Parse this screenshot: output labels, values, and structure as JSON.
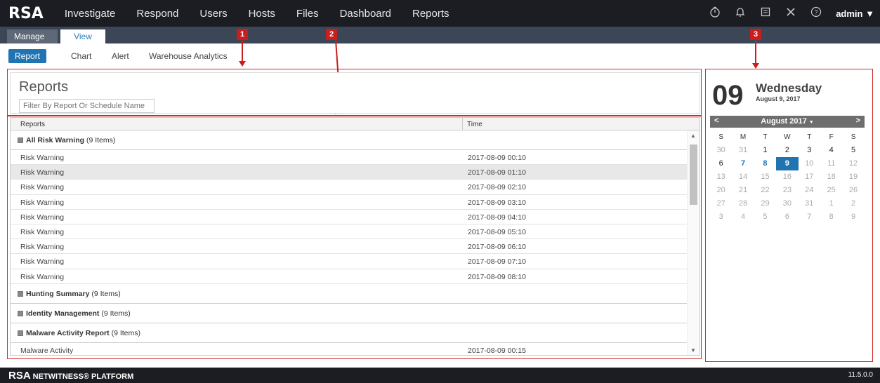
{
  "app": {
    "logo": "RSA",
    "nav": [
      "Investigate",
      "Respond",
      "Users",
      "Hosts",
      "Files",
      "Dashboard",
      "Reports"
    ],
    "user": "admin",
    "icons": [
      "timer-icon",
      "bell-icon",
      "notes-icon",
      "tools-icon",
      "help-icon"
    ]
  },
  "tabs": {
    "manage": "Manage",
    "view": "View"
  },
  "subtabs": [
    "Report",
    "Chart",
    "Alert",
    "Warehouse Analytics"
  ],
  "markers": [
    "1",
    "2",
    "3"
  ],
  "reports": {
    "title": "Reports",
    "filter_placeholder": "Filter By Report Or Schedule Name",
    "col_reports": "Reports",
    "col_time": "Time",
    "groups": [
      {
        "name": "All Risk Warning",
        "count": "(9 Items)"
      },
      {
        "name": "Hunting Summary",
        "count": "(9 Items)"
      },
      {
        "name": "Identity Management",
        "count": "(9 Items)"
      },
      {
        "name": "Malware Activity Report",
        "count": "(9 Items)"
      }
    ],
    "risk_rows": [
      {
        "name": "Risk Warning",
        "time": "2017-08-09 00:10"
      },
      {
        "name": "Risk Warning",
        "time": "2017-08-09 01:10"
      },
      {
        "name": "Risk Warning",
        "time": "2017-08-09 02:10"
      },
      {
        "name": "Risk Warning",
        "time": "2017-08-09 03:10"
      },
      {
        "name": "Risk Warning",
        "time": "2017-08-09 04:10"
      },
      {
        "name": "Risk Warning",
        "time": "2017-08-09 05:10"
      },
      {
        "name": "Risk Warning",
        "time": "2017-08-09 06:10"
      },
      {
        "name": "Risk Warning",
        "time": "2017-08-09 07:10"
      },
      {
        "name": "Risk Warning",
        "time": "2017-08-09 08:10"
      }
    ],
    "malware_rows": [
      {
        "name": "Malware Activity",
        "time": "2017-08-09 00:15"
      }
    ]
  },
  "calendar": {
    "day_number": "09",
    "weekday": "Wednesday",
    "full_date": "August 9, 2017",
    "month_label": "August 2017",
    "prev": "<",
    "next": ">",
    "dow": [
      "S",
      "M",
      "T",
      "W",
      "T",
      "F",
      "S"
    ],
    "weeks": [
      [
        "30",
        "31",
        "1",
        "2",
        "3",
        "4",
        "5"
      ],
      [
        "6",
        "7",
        "8",
        "9",
        "10",
        "11",
        "12"
      ],
      [
        "13",
        "14",
        "15",
        "16",
        "17",
        "18",
        "19"
      ],
      [
        "20",
        "21",
        "22",
        "23",
        "24",
        "25",
        "26"
      ],
      [
        "27",
        "28",
        "29",
        "30",
        "31",
        "1",
        "2"
      ],
      [
        "3",
        "4",
        "5",
        "6",
        "7",
        "8",
        "9"
      ]
    ]
  },
  "footer": {
    "logo": "RSA",
    "product": "NETWITNESS® PLATFORM",
    "version": "11.5.0.0"
  }
}
